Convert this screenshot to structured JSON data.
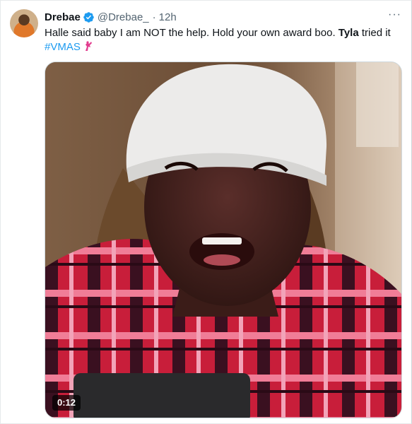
{
  "tweet": {
    "author_name": "Drebae",
    "handle": "@Drebae_",
    "separator": "·",
    "time": "12h",
    "more_icon": "more-horizontal-icon",
    "verified_icon": "verified-badge-icon",
    "verified_color": "#1d9bf0",
    "text_part1": "Halle said baby I am NOT the help. Hold your own award boo. ",
    "text_bold": "Tyla",
    "text_part2": " tried it",
    "hashtag": "#VMAS",
    "hashtag_emoji_icon": "vma-astronaut-emoji-icon",
    "hashtag_color": "#1d9bf0"
  },
  "video": {
    "duration": "0:12"
  }
}
